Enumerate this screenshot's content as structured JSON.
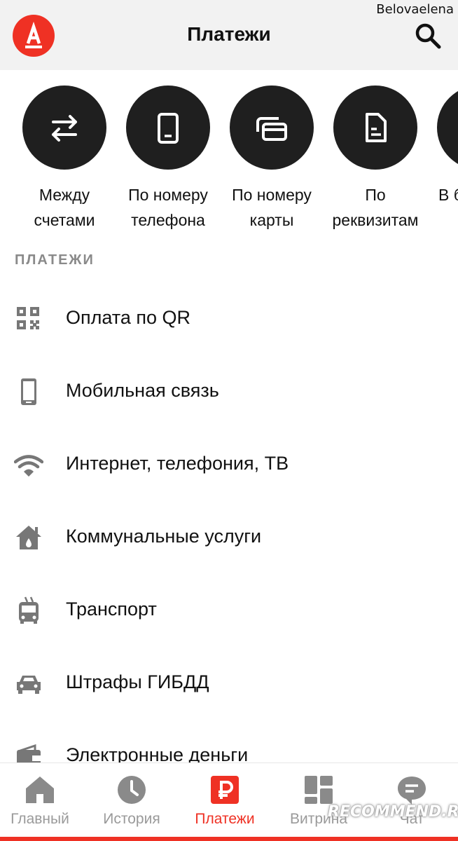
{
  "user_label": "Belovaelena",
  "header": {
    "title": "Платежи",
    "logo_icon": "alfa-logo-icon",
    "search_icon": "search-icon"
  },
  "quick_actions": [
    {
      "label": "Между\nсчетами",
      "icon": "transfer-arrows-icon"
    },
    {
      "label": "По номеру\nтелефона",
      "icon": "phone-icon"
    },
    {
      "label": "По номеру\nкарты",
      "icon": "cards-icon"
    },
    {
      "label": "По\nреквизитам",
      "icon": "document-icon"
    },
    {
      "label": "В б",
      "icon": "more-icon"
    }
  ],
  "section_title": "ПЛАТЕЖИ",
  "payments": [
    {
      "label": "Оплата по QR",
      "icon": "qr-code-icon"
    },
    {
      "label": "Мобильная связь",
      "icon": "mobile-phone-icon"
    },
    {
      "label": "Интернет, телефония, ТВ",
      "icon": "wifi-icon"
    },
    {
      "label": "Коммунальные услуги",
      "icon": "house-icon"
    },
    {
      "label": "Транспорт",
      "icon": "trolleybus-icon"
    },
    {
      "label": "Штрафы ГИБДД",
      "icon": "car-icon"
    },
    {
      "label": "Электронные деньги",
      "icon": "wallet-icon"
    }
  ],
  "nav": [
    {
      "label": "Главный",
      "icon": "home-icon"
    },
    {
      "label": "История",
      "icon": "clock-icon"
    },
    {
      "label": "Платежи",
      "icon": "ruble-icon",
      "active": true
    },
    {
      "label": "Витрина",
      "icon": "grid-icon"
    },
    {
      "label": "Чат",
      "icon": "chat-icon"
    }
  ],
  "watermark": "RECOMMEND.RU",
  "colors": {
    "brand_red": "#ef3124",
    "circle_dark": "#1f1f1f",
    "icon_gray": "#777777"
  }
}
